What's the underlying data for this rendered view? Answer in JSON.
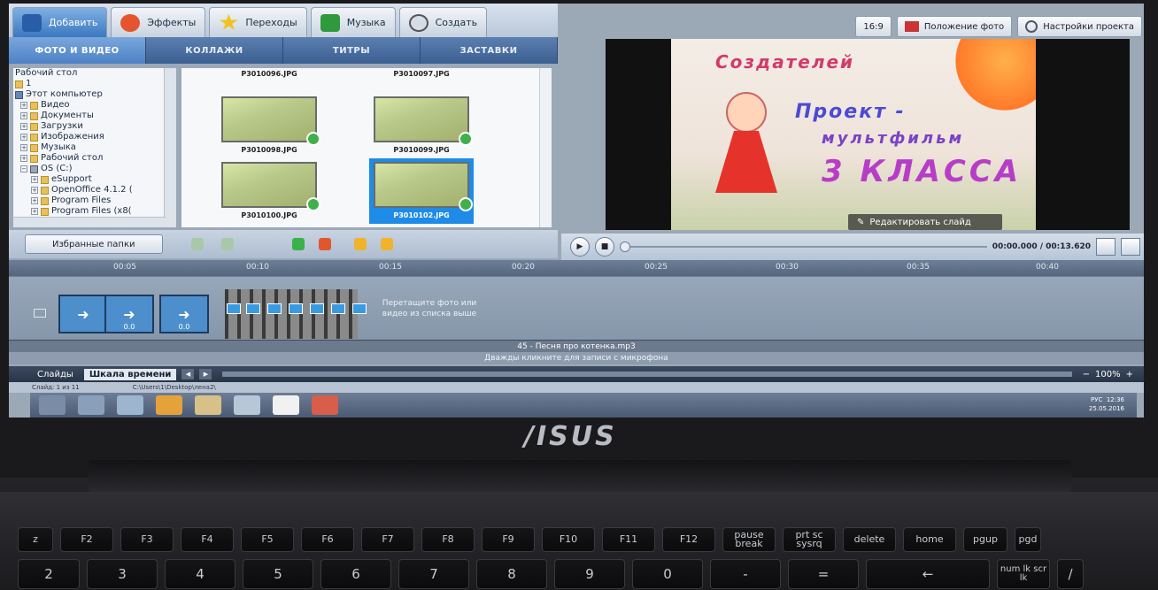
{
  "top_tabs": [
    "Добавить",
    "Эффекты",
    "Переходы",
    "Музыка",
    "Создать"
  ],
  "sub_tabs": [
    "ФОТО И ВИДЕО",
    "КОЛЛАЖИ",
    "ТИТРЫ",
    "ЗАСТАВКИ"
  ],
  "tree": {
    "items": [
      "Рабочий стол",
      "1",
      "Этот компьютер",
      "Видео",
      "Документы",
      "Загрузки",
      "Изображения",
      "Музыка",
      "Рабочий стол",
      "OS (C:)",
      "eSupport",
      "OpenOffice 4.1.2 (",
      "Program Files",
      "Program Files (x8("
    ]
  },
  "thumbnails": [
    {
      "name": "P3010096.JPG"
    },
    {
      "name": "P3010097.JPG"
    },
    {
      "name": "P3010098.JPG"
    },
    {
      "name": "P3010099.JPG"
    },
    {
      "name": "P3010100.JPG"
    },
    {
      "name": "P3010102.JPG"
    }
  ],
  "favorites_label": "Избранные папки",
  "preview_buttons": [
    "16:9",
    "Положение фото",
    "Настройки проекта"
  ],
  "slide_text": [
    "Создателей",
    "Проект -",
    "мультфильм",
    "3 КЛАССА"
  ],
  "edit_slide_label": "Редактировать слайд",
  "time_display": "00:00.000 / 00:13.620",
  "ruler_ticks": [
    "00:05",
    "00:10",
    "00:15",
    "00:20",
    "00:25",
    "00:30",
    "00:35",
    "00:40"
  ],
  "clip_values": [
    "0.0",
    "0.0"
  ],
  "drop_hint": "Перетащите фото или видео из списка выше",
  "audio_track": "45 - Песня про котенка.mp3",
  "mic_hint": "Дважды кликните для записи с микрофона",
  "bottom_tabs": [
    "Слайды",
    "Шкала времени"
  ],
  "zoom": "100%",
  "status": [
    "Слайд: 1 из 11",
    "C:\\Users\\1\\Desktop\\лена2\\"
  ],
  "tray": {
    "lang": "РУС",
    "time": "12:36",
    "date": "25.05.2016"
  },
  "laptop_logo": "/ISUS",
  "keys_row1": [
    "z",
    "F2",
    "F3",
    "F4",
    "F5",
    "F6",
    "F7",
    "F8",
    "F9",
    "F10",
    "F11",
    "F12",
    "pause break",
    "prt sc sysrq",
    "delete",
    "home",
    "pgup",
    "pgd"
  ],
  "keys_row2": [
    "2",
    "3",
    "4",
    "5",
    "6",
    "7",
    "8",
    "9",
    "0",
    "-",
    "=",
    "←",
    "num lk scr lk",
    "/"
  ]
}
